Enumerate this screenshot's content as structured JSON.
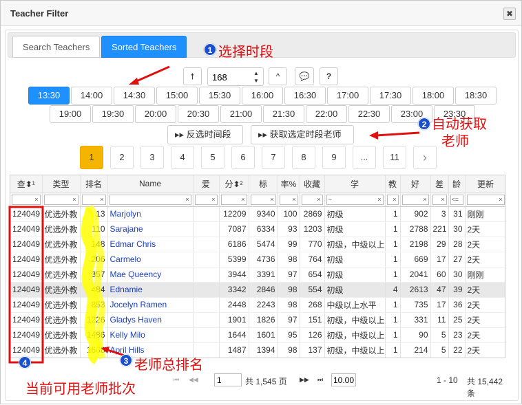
{
  "window": {
    "title": "Teacher Filter",
    "close_label": "✖"
  },
  "tabs": [
    {
      "label": "Search Teachers",
      "active": false
    },
    {
      "label": "Sorted Teachers",
      "active": true
    }
  ],
  "toolbar": {
    "up_label": "🠕",
    "stepper_value": "168",
    "caret_label": "^",
    "comment_label": "💬",
    "help_label": "?"
  },
  "time_slots_row1": [
    "13:30",
    "14:00",
    "14:30",
    "15:00",
    "15:30",
    "16:00",
    "16:30",
    "17:00",
    "17:30",
    "18:00",
    "18:30"
  ],
  "time_slots_row2": [
    "19:00",
    "19:30",
    "20:00",
    "20:30",
    "21:00",
    "21:30",
    "22:00",
    "22:30",
    "23:00",
    "23:30"
  ],
  "active_slot": "13:30",
  "actions": {
    "invert_label": "▸▸ 反选时间段",
    "fetch_label": "▸▸ 获取选定时段老师"
  },
  "pagination": {
    "pages": [
      "1",
      "2",
      "3",
      "4",
      "5",
      "6",
      "7",
      "8",
      "9",
      "...",
      "11"
    ],
    "next_label": "›",
    "active": "1"
  },
  "table": {
    "headers": [
      "查⬍¹",
      "类型",
      "排名",
      "Name",
      "爱",
      "分⬍²",
      "标",
      "率%",
      "收藏",
      "学",
      "教",
      "好",
      "差",
      "龄",
      "更新"
    ],
    "filter_placeholders": {
      "learn": "~",
      "age": "<="
    },
    "rows": [
      [
        "124049",
        "优选外教",
        "13",
        "Marjolyn",
        "",
        "12209",
        "9340",
        "100",
        "2869",
        "初级",
        "1",
        "902",
        "3",
        "31",
        "刚刚"
      ],
      [
        "124049",
        "优选外教",
        "110",
        "Sarajane",
        "",
        "7087",
        "6334",
        "93",
        "1203",
        "初级",
        "1",
        "2788",
        "221",
        "30",
        "2天"
      ],
      [
        "124049",
        "优选外教",
        "148",
        "Edmar Chris",
        "",
        "6186",
        "5474",
        "99",
        "770",
        "初级，中级以上",
        "1",
        "2198",
        "29",
        "28",
        "2天"
      ],
      [
        "124049",
        "优选外教",
        "206",
        "Carmelo",
        "",
        "5399",
        "4736",
        "98",
        "764",
        "初级",
        "1",
        "669",
        "17",
        "27",
        "2天"
      ],
      [
        "124049",
        "优选外教",
        "357",
        "Mae Queency",
        "",
        "3944",
        "3391",
        "97",
        "654",
        "初级",
        "1",
        "2041",
        "60",
        "30",
        "刚刚"
      ],
      [
        "124049",
        "优选外教",
        "484",
        "Ednamie",
        "",
        "3342",
        "2846",
        "98",
        "554",
        "初级",
        "4",
        "2613",
        "47",
        "39",
        "2天"
      ],
      [
        "124049",
        "优选外教",
        "853",
        "Jocelyn Ramen",
        "",
        "2448",
        "2243",
        "98",
        "268",
        "中级以上水平",
        "1",
        "735",
        "17",
        "36",
        "2天"
      ],
      [
        "124049",
        "优选外教",
        "1226",
        "Gladys Haven",
        "",
        "1901",
        "1826",
        "97",
        "151",
        "初级，中级以上",
        "1",
        "331",
        "11",
        "25",
        "2天"
      ],
      [
        "124049",
        "优选外教",
        "1486",
        "Kelly Milo",
        "",
        "1644",
        "1601",
        "95",
        "126",
        "初级，中级以上",
        "1",
        "90",
        "5",
        "23",
        "2天"
      ],
      [
        "124049",
        "优选外教",
        "1668",
        "April Hills",
        "",
        "1487",
        "1394",
        "98",
        "137",
        "初级，中级以上",
        "1",
        "214",
        "5",
        "22",
        "2天"
      ]
    ],
    "highlighted_row": 5
  },
  "footer": {
    "first": "⏮",
    "prev": "◀◀",
    "page_input": "1",
    "total_pages": "共 1,545 页",
    "next": "▶▶",
    "last": "⏭",
    "page_size": "10.00",
    "range": "1 - 10",
    "total": "共 15,442 条"
  },
  "annotations": {
    "a1": "选择时段",
    "a2_line1": "自动获取",
    "a2_line2": "老师",
    "a3": "老师总排名",
    "a4": "当前可用老师批次",
    "n1": "1",
    "n2": "2",
    "n3": "3",
    "n4": "4"
  },
  "colors": {
    "accent": "#1e90ff",
    "active_page": "#f5b400",
    "annotation_red": "#e01010",
    "highlighter": "#ffff00"
  }
}
